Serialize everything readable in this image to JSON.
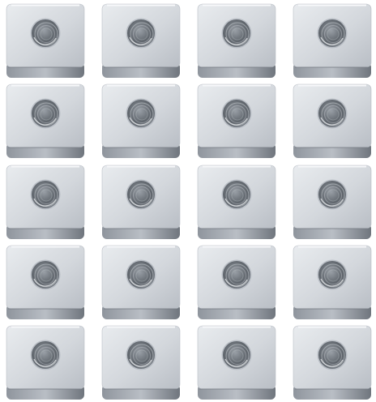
{
  "image": {
    "subject": "square-nut",
    "rows": 5,
    "columns": 4,
    "background_color": "#ffffff",
    "nut_colors": {
      "top_face_light": "#e9ecef",
      "top_face_mid": "#d3d7dc",
      "top_face_dark": "#b9bec5",
      "side_face": "#8f959d",
      "side_face_dark": "#6f757d",
      "edge_highlight": "#f7f8fa",
      "hole_dark": "#5f656c",
      "hole_mid": "#9aa0a7",
      "thread_light": "#c9cdd2"
    }
  }
}
